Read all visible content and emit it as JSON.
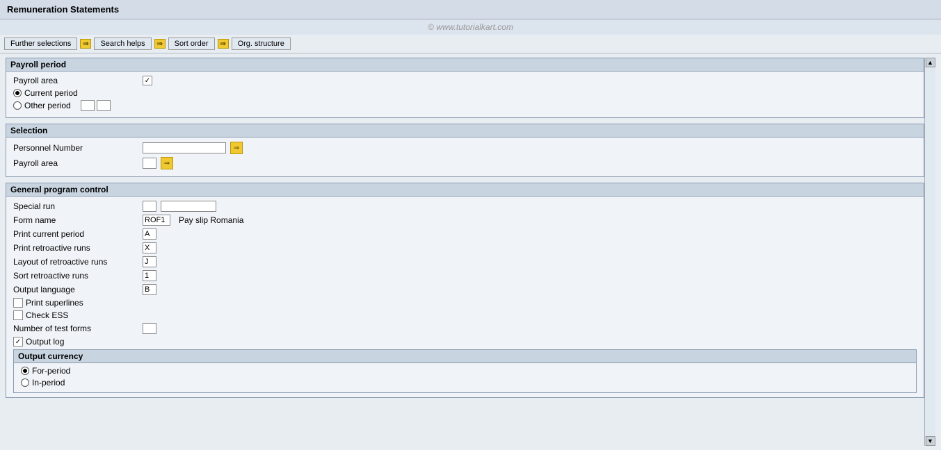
{
  "title": "Remuneration Statements",
  "watermark": "© www.tutorialkart.com",
  "toolbar": {
    "further_selections": "Further selections",
    "search_helps": "Search helps",
    "sort_order": "Sort order",
    "org_structure": "Org. structure"
  },
  "payroll_period": {
    "title": "Payroll period",
    "payroll_area_label": "Payroll area",
    "payroll_area_checked": true,
    "current_period_label": "Current period",
    "current_period_selected": true,
    "other_period_label": "Other period",
    "other_period_val1": "",
    "other_period_val2": ""
  },
  "selection": {
    "title": "Selection",
    "personnel_number_label": "Personnel Number",
    "personnel_number_value": "",
    "payroll_area_label": "Payroll area",
    "payroll_area_value": ""
  },
  "general_program_control": {
    "title": "General program control",
    "special_run_label": "Special run",
    "special_run_val1": "",
    "special_run_val2": "",
    "form_name_label": "Form name",
    "form_name_value": "ROF1",
    "form_name_description": "Pay slip Romania",
    "print_current_period_label": "Print current period",
    "print_current_period_value": "A",
    "print_retroactive_runs_label": "Print retroactive runs",
    "print_retroactive_runs_value": "X",
    "layout_retroactive_label": "Layout of retroactive runs",
    "layout_retroactive_value": "J",
    "sort_retroactive_label": "Sort retroactive runs",
    "sort_retroactive_value": "1",
    "output_language_label": "Output language",
    "output_language_value": "B",
    "print_superlines_label": "Print superlines",
    "print_superlines_checked": false,
    "check_ess_label": "Check ESS",
    "check_ess_checked": false,
    "number_of_test_forms_label": "Number of test forms",
    "number_of_test_forms_value": "",
    "output_log_label": "Output log",
    "output_log_checked": true
  },
  "output_currency": {
    "title": "Output currency",
    "for_period_label": "For-period",
    "for_period_selected": true,
    "in_period_label": "In-period",
    "in_period_selected": false
  }
}
